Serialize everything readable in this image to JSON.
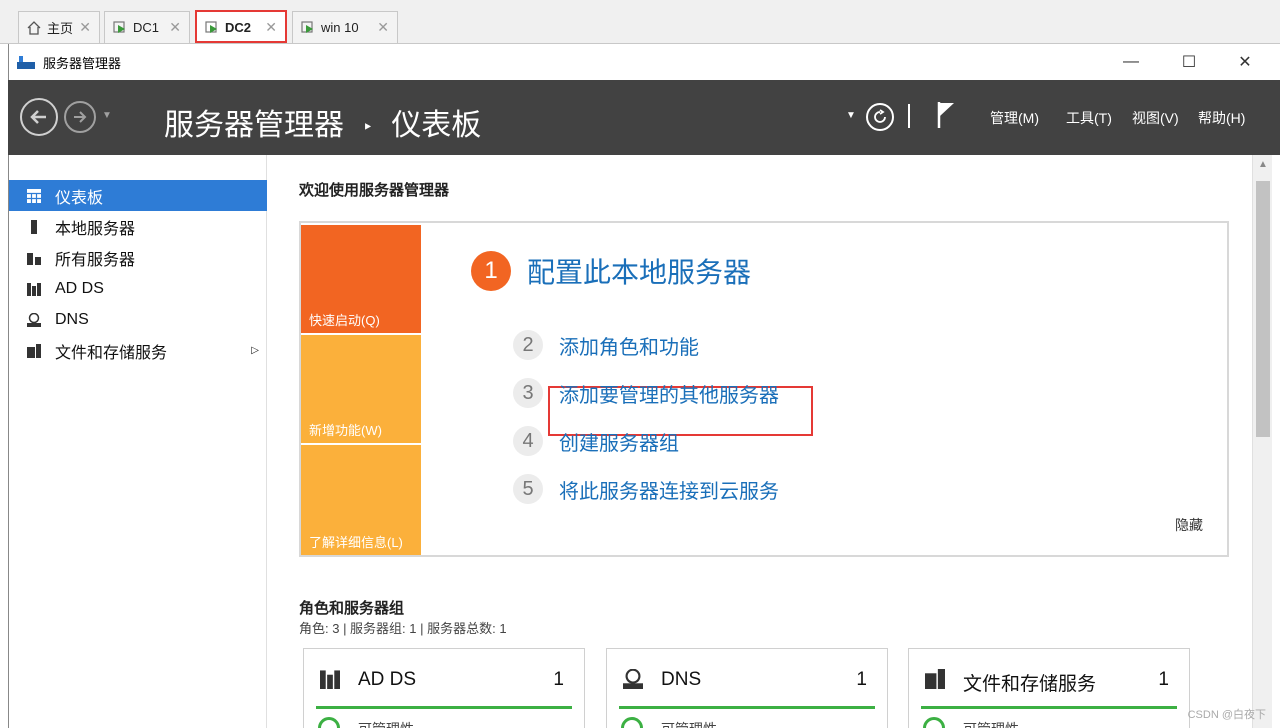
{
  "tabs": [
    {
      "label": "主页",
      "icon": "home-icon"
    },
    {
      "label": "DC1",
      "icon": "vm-icon"
    },
    {
      "label": "DC2",
      "icon": "vm-icon"
    },
    {
      "label": "win 10",
      "icon": "vm-icon"
    }
  ],
  "window": {
    "title": "服务器管理器",
    "minimize": "—",
    "maximize": "☐",
    "close": "✕"
  },
  "header": {
    "breadcrumb_app": "服务器管理器",
    "breadcrumb_sep": "‣",
    "breadcrumb_page": "仪表板",
    "menus": [
      "管理(M)",
      "工具(T)",
      "视图(V)",
      "帮助(H)"
    ]
  },
  "sidebar": {
    "items": [
      {
        "label": "仪表板"
      },
      {
        "label": "本地服务器"
      },
      {
        "label": "所有服务器"
      },
      {
        "label": "AD DS"
      },
      {
        "label": "DNS"
      },
      {
        "label": "文件和存储服务"
      }
    ]
  },
  "welcome": {
    "title": "欢迎使用服务器管理器",
    "tiles": [
      "快速启动(Q)",
      "新增功能(W)",
      "了解详细信息(L)"
    ],
    "step1": {
      "num": "1",
      "label": "配置此本地服务器"
    },
    "steps": [
      {
        "num": "2",
        "label": "添加角色和功能"
      },
      {
        "num": "3",
        "label": "添加要管理的其他服务器"
      },
      {
        "num": "4",
        "label": "创建服务器组"
      },
      {
        "num": "5",
        "label": "将此服务器连接到云服务"
      }
    ],
    "hide": "隐藏"
  },
  "roles": {
    "title": "角色和服务器组",
    "summary": "角色: 3 | 服务器组: 1 | 服务器总数: 1",
    "cards": [
      {
        "name": "AD DS",
        "count": "1",
        "status": "可管理性"
      },
      {
        "name": "DNS",
        "count": "1",
        "status": "可管理性"
      },
      {
        "name": "文件和存储服务",
        "count": "1",
        "status": "可管理性"
      }
    ]
  },
  "watermark": "CSDN @白夜下",
  "colors": {
    "accent": "#2e7cd6",
    "orange": "#f26522",
    "tile_dark": "#f26522",
    "tile_light": "#fbb03b",
    "link": "#1a6fb9",
    "ok": "#3cb043"
  }
}
